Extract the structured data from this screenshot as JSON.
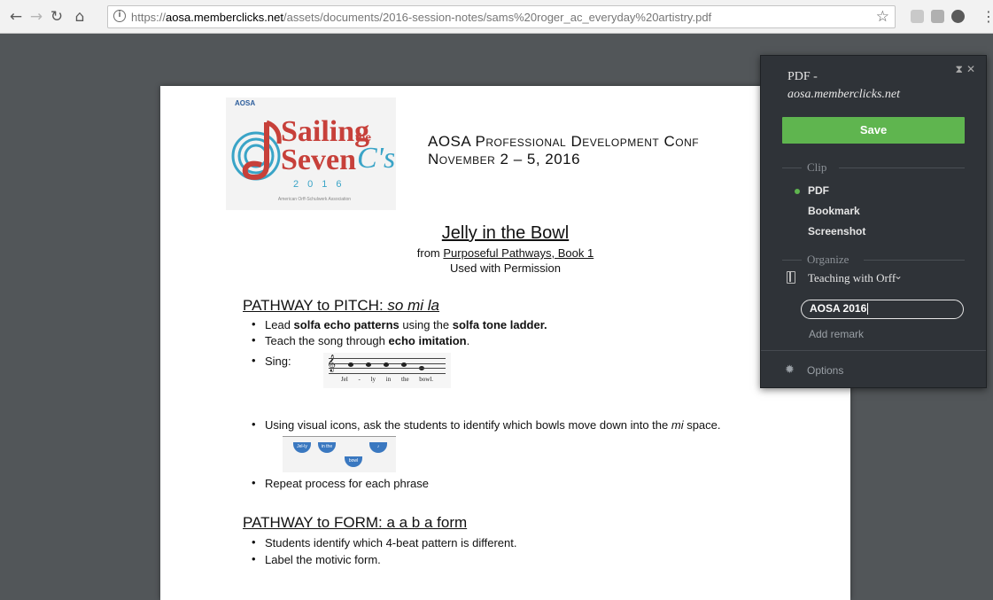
{
  "browser": {
    "url_scheme": "https://",
    "url_host": "aosa.memberclicks.net",
    "url_path": "/assets/documents/2016-session-notes/sams%20roger_ac_everyday%20artistry.pdf",
    "info_icon": "i"
  },
  "document": {
    "logo": {
      "aosa": "AOSA",
      "sailing": "Sailing",
      "the": "the",
      "seven": "Seven",
      "cs": "C's",
      "year": "2016",
      "association": "American Orff-Schulwerk Association"
    },
    "conference_line1": "AOSA Professional Development Conf",
    "conference_line2": "November 2 – 5, 2016",
    "title": "Jelly in the Bowl",
    "from_prefix": "from ",
    "from_source": "Purposeful Pathways, Book 1",
    "permission": "Used with Permission",
    "pitch_heading": "PATHWAY to PITCH: ",
    "pitch_heading_italic": "so mi la",
    "pitch_bullets": {
      "b1_a": "Lead ",
      "b1_b": "solfa echo patterns",
      "b1_c": " using the ",
      "b1_d": "solfa tone ladder.",
      "b2_a": "Teach the song through ",
      "b2_b": "echo imitation",
      "b2_c": ".",
      "b3": "Sing:",
      "b4_a": "Using visual icons, ask the students to identify which bowls move down into the ",
      "b4_b": "mi",
      "b4_c": " space.",
      "b5": "Repeat process for each phrase"
    },
    "lyrics": "Jel - ly in the bowl.",
    "bowls": [
      "Jel-ly",
      "in the",
      "bowl",
      "♪"
    ],
    "form_heading": "PATHWAY to FORM: a a b a form",
    "form_bullets": [
      "Students identify which 4-beat pattern is different.",
      "Label the motivic form."
    ]
  },
  "clipper": {
    "title_line1": "PDF -",
    "title_line2": "aosa.memberclicks.net",
    "save_label": "Save",
    "clip_section": "Clip",
    "clip_options": [
      "PDF",
      "Bookmark",
      "Screenshot"
    ],
    "selected_option": "PDF",
    "organize_section": "Organize",
    "notebook": "Teaching with Orff",
    "tag_value": "AOSA 2016",
    "remark_placeholder": "Add remark",
    "options_label": "Options"
  },
  "colors": {
    "save_green": "#5fb54f",
    "panel_bg": "#2f3338",
    "logo_red": "#c7403a",
    "logo_blue": "#3aa4c7"
  }
}
